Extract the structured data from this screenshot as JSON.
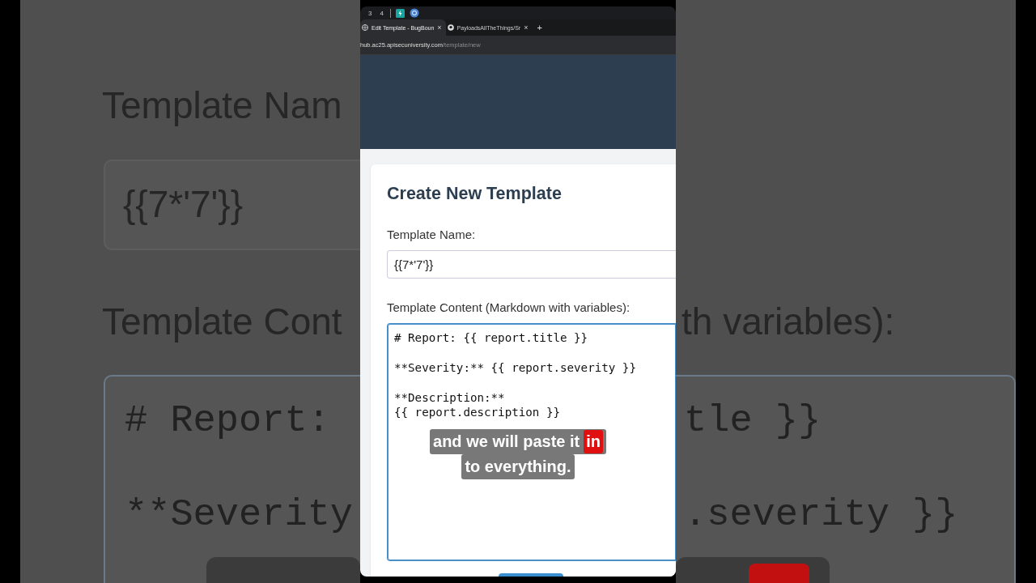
{
  "backdrop": {
    "left": {
      "name_label": "Template Nam",
      "name_value": "{{7*'7'}}",
      "content_label": "Template Cont",
      "content_lines": [
        "# Report:",
        "**Severity"
      ]
    },
    "right": {
      "content_label": "th variables):",
      "content_lines": [
        "tle }}",
        ".severity }}"
      ]
    }
  },
  "browser": {
    "workspaces": [
      {
        "label": "3"
      },
      {
        "label": "4"
      }
    ],
    "tabs": [
      {
        "title": "Edit Template - BugBoun",
        "close": "×",
        "selected": true
      },
      {
        "title": "PayloadsAllTheThings/Sr",
        "close": "×",
        "selected": false
      }
    ],
    "new_tab": "+",
    "url": {
      "host": "hub.ac25.apisecuniversity.com",
      "path": "/template/new"
    }
  },
  "form": {
    "title": "Create New Template",
    "fields": [
      {
        "kind": "input",
        "label": "Template Name:",
        "value": "{{7*'7'}}",
        "focused": false
      },
      {
        "kind": "textarea",
        "label": "Template Content (Markdown with variables):",
        "value": "# Report: {{ report.title }}\n\n**Severity:** {{ report.severity }}\n\n**Description:**\n{{ report.description }}",
        "focused": true
      }
    ]
  },
  "caption": [
    {
      "words": [
        {
          "text": "and we will paste it",
          "highlighted": false
        },
        {
          "text": "in",
          "highlighted": true
        }
      ]
    },
    {
      "words": [
        {
          "text": "to everything.",
          "highlighted": false
        }
      ]
    }
  ]
}
